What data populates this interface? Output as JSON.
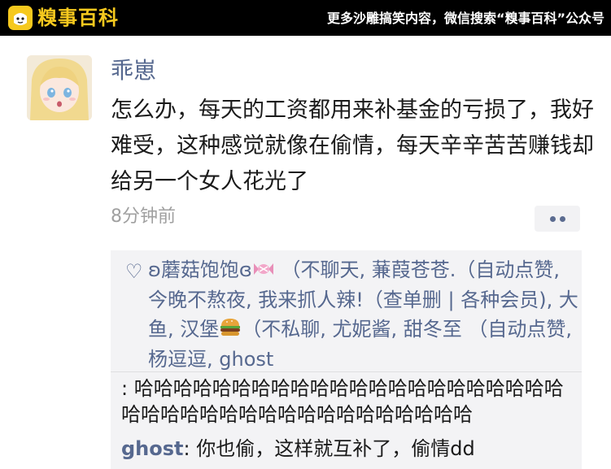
{
  "header": {
    "logo_text": "糗事百科",
    "slogan": "更多沙雕搞笑内容，微信搜索“糗事百科”公众号"
  },
  "post": {
    "username": "乖崽",
    "content": "怎么办，每天的工资都用来补基金的亏损了，我好难受，这种感觉就像在偷情，每天辛辛苦苦赚钱却给另一个女人花光了",
    "time": "8分钟前"
  },
  "likes": {
    "part1": "ʚ蘑菇饱饱ɞ",
    "part2": "（不聊天, 蒹葭苍苍.（自动点赞, 今晚不熬夜, 我来抓人辣!（查单删 | 各种会员), 大鱼, 汉堡",
    "part3": "（不私聊, 尤妮酱, 甜冬至 （自动点赞, 杨逗逗, ghost"
  },
  "comments": [
    {
      "name": "",
      "text": ": 哈哈哈哈哈哈哈哈哈哈哈哈哈哈哈哈哈哈哈哈哈哈哈哈哈哈哈哈哈哈哈哈哈哈哈哈哈哈哈哈"
    },
    {
      "name": "ghost",
      "text": ": 你也偷，这样就互补了，偷情dd"
    }
  ],
  "colors": {
    "link": "#56688f",
    "logo": "#f6c91e",
    "panel": "#f3f3f5"
  },
  "icons": [
    "logo-face-icon",
    "heart-icon",
    "candy-emoji-icon",
    "burger-emoji-icon",
    "more-dots-icon"
  ]
}
